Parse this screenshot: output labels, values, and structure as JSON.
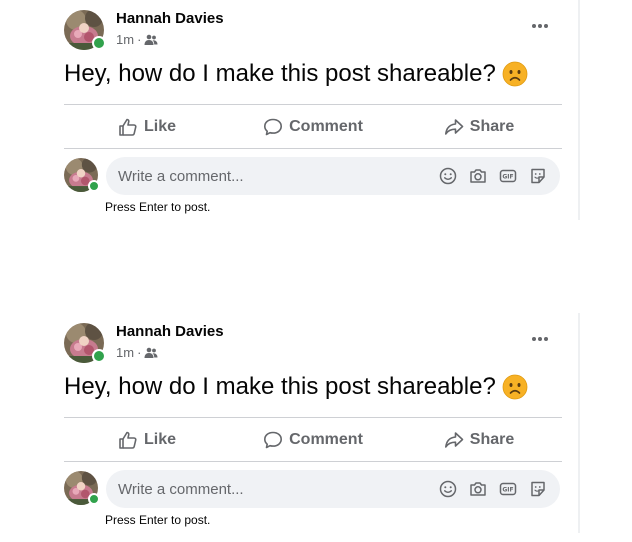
{
  "posts": [
    {
      "author": "Hannah Davies",
      "time": "1m",
      "separator": "·",
      "audience_icon": "friends-icon",
      "text": "Hey, how do I make this post shareable?",
      "emoji": "sad-face-emoji",
      "actions": {
        "like": "Like",
        "comment": "Comment",
        "share": "Share"
      },
      "comment_placeholder": "Write a comment...",
      "hint": "Press Enter to post.",
      "online": true
    },
    {
      "author": "Hannah Davies",
      "time": "1m",
      "separator": "·",
      "audience_icon": "friends-icon",
      "text": "Hey, how do I make this post shareable?",
      "emoji": "sad-face-emoji",
      "actions": {
        "like": "Like",
        "comment": "Comment",
        "share": "Share"
      },
      "comment_placeholder": "Write a comment...",
      "hint": "Press Enter to post.",
      "online": true
    }
  ],
  "colors": {
    "online": "#31a24c",
    "secondary_text": "#65676b",
    "input_bg": "#f0f2f5",
    "divider": "#ced0d4"
  }
}
